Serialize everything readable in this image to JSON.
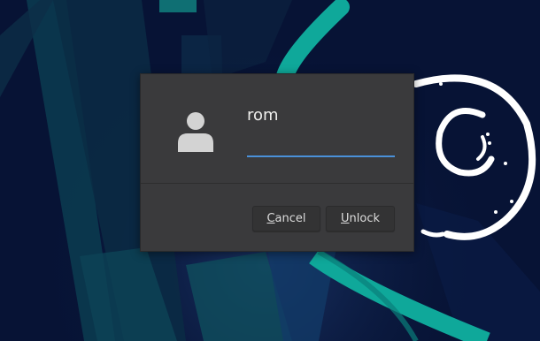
{
  "dialog": {
    "username": "rom",
    "password": {
      "value": "",
      "placeholder": ""
    },
    "cancel_button": {
      "mnemonic": "C",
      "rest": "ancel"
    },
    "unlock_button": {
      "mnemonic": "U",
      "rest": "nlock"
    },
    "avatar_icon": "user-avatar-icon"
  },
  "wallpaper": {
    "background_color": "#071335",
    "accent_color": "#0fa89a",
    "swirl_color": "#ffffff"
  },
  "colors": {
    "dialog_bg": "#3a3a3c",
    "focus_underline": "#4a90d9",
    "text": "#eeeeec"
  }
}
